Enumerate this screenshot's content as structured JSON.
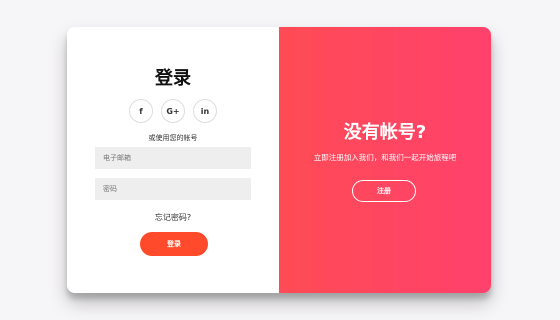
{
  "login": {
    "title": "登录",
    "socials": [
      {
        "label": "f",
        "icon": "facebook-icon"
      },
      {
        "label": "G+",
        "icon": "google-plus-icon"
      },
      {
        "label": "in",
        "icon": "linkedin-icon"
      }
    ],
    "hint": "或使用您的帐号",
    "email_placeholder": "电子邮箱",
    "password_placeholder": "密码",
    "forgot": "忘记密码?",
    "button": "登录"
  },
  "overlay": {
    "title": "没有帐号?",
    "text": "立即注册加入我们，和我们一起开始旅程吧",
    "button": "注册"
  },
  "colors": {
    "accent": "#ff4b2b",
    "overlay_start": "#ff4b55",
    "overlay_end": "#ff416c"
  }
}
